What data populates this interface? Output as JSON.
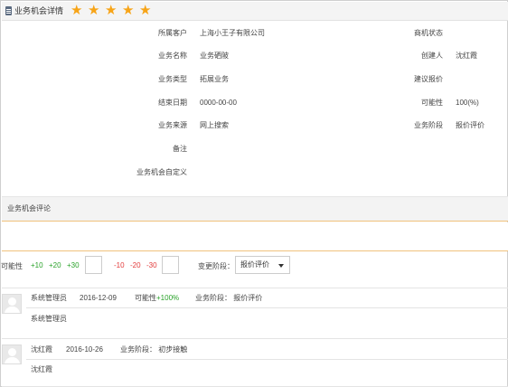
{
  "header": {
    "title": "业务机会详情",
    "rating": 5,
    "star_glyph": "★",
    "star_color": "#f7a417"
  },
  "details": {
    "customer_label": "所属客户",
    "customer": "上海小王子有限公司",
    "name_label": "业务名称",
    "name": "业务硒陂",
    "type_label": "业务类型",
    "type": "拓展业务",
    "end_label": "结束日期",
    "end": "0000-00-00",
    "source_label": "业务来源",
    "source": "网上搜索",
    "note_label": "备注",
    "custom_label": "业务机会自定义",
    "status_label": "商机状态",
    "creator_label": "创建人",
    "creator": "沈红霞",
    "quote_label": "建议报价",
    "possibility_label": "可能性",
    "possibility": "100(%)",
    "stage_label": "业务阶段",
    "stage": "报价评价"
  },
  "evaluation": {
    "title": "业务机会评论",
    "possibility_label": "可能性",
    "plus": [
      "+10",
      "+20",
      "+30"
    ],
    "minus": [
      "-10",
      "-20",
      "-30"
    ],
    "change_stage_label": "变更阶段：",
    "stage_select": "报价评价"
  },
  "comments": [
    {
      "author": "系统管理员",
      "date": "2016-12-09",
      "possibility_prefix": "可能性",
      "possibility_value": "+100%",
      "stage_text": "业务阶段： 报价评价",
      "body": "系统管理员"
    },
    {
      "author": "沈红霞",
      "date": "2016-10-26",
      "stage_text": "业务阶段： 初步接触",
      "body": "沈红霞"
    }
  ]
}
